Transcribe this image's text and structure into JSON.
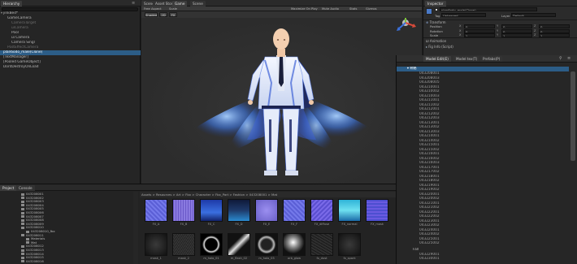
{
  "hierarchy": {
    "tab_label": "Hierarchy",
    "scene_name": "jinkBed*",
    "items": [
      {
        "text": "GameCamera",
        "indent": 1,
        "dim": false,
        "selected": false
      },
      {
        "text": "CameraTarget",
        "indent": 2,
        "dim": true,
        "selected": false
      },
      {
        "text": "uiCamera",
        "indent": 2,
        "dim": true,
        "selected": false
      },
      {
        "text": "Pool",
        "indent": 2,
        "dim": false,
        "selected": false
      },
      {
        "text": "ui Camera",
        "indent": 2,
        "dim": false,
        "selected": false
      },
      {
        "text": "Camera Singl",
        "indent": 2,
        "dim": false,
        "selected": false
      },
      {
        "text": "PostEffectCamera",
        "indent": 1,
        "dim": true,
        "selected": false
      },
      {
        "text": "plan6odo_male(Clone)",
        "indent": 0,
        "dim": false,
        "selected": true
      },
      {
        "text": "[TextManager]",
        "indent": 0,
        "dim": false,
        "selected": false
      },
      {
        "text": "[Pooled GameObject]",
        "indent": 0,
        "dim": false,
        "selected": false
      },
      {
        "text": "DontDestroyOnLoad",
        "indent": 0,
        "dim": false,
        "selected": false
      }
    ]
  },
  "scene": {
    "tabs": [
      "Scene",
      "Asset Store",
      "Game",
      "Scene"
    ],
    "toolbar": [
      "Free Aspect",
      "Scale",
      "Maximize On Play",
      "Mute Audio",
      "Stats",
      "Gizmos"
    ],
    "sub_toolbar": [
      "Shaded",
      "2D",
      "FX"
    ],
    "axes": {
      "y": "y",
      "x": "x",
      "z": "z"
    }
  },
  "inspector": {
    "tab_label": "Inspector",
    "object_name": "plan6odo_male(Clone)",
    "tag_label": "Tag",
    "tag_value": "Untagged",
    "layer_label": "Layer",
    "layer_value": "Default",
    "transform_label": "Transform",
    "position_label": "Position",
    "rotation_label": "Rotation",
    "scale_label": "Scale",
    "x": "X",
    "y": "Y",
    "z": "Z",
    "position_values": [
      "0",
      "0",
      "0"
    ],
    "rotation_values": [
      "0",
      "0",
      "0"
    ],
    "scale_values": [
      "1",
      "1",
      "1"
    ],
    "animation_label": "Animation",
    "script_label": "Fig Info (Script)"
  },
  "model_panel": {
    "tabs": [
      "Model Edit(E)",
      "Model tex(T)",
      "Prefabs(P)"
    ],
    "root_label": "骨骼",
    "entries": [
      "043208001",
      "043208003",
      "043208005",
      "043210001",
      "043210002",
      "043210003",
      "043211001",
      "043211002",
      "043212001",
      "043212002",
      "043212003",
      "043213001",
      "043213002",
      "043213003",
      "043214001",
      "043214002",
      "043215001",
      "043215002",
      "043216001",
      "043216002",
      "043216003",
      "043217001",
      "043217002",
      "043218001",
      "043218002",
      "043219001",
      "043219002",
      "043220001",
      "043220002",
      "043221001",
      "043221002",
      "043222001",
      "043222002",
      "043223001",
      "043223002",
      "043224001",
      "043224002",
      "043225001",
      "043225002"
    ],
    "footer_label": "Fall",
    "footer_entries": [
      "043229001",
      "043230001"
    ]
  },
  "project": {
    "tabs": [
      "Project",
      "Console"
    ],
    "breadcrumb": "Assets > Resources > Art > Fbx > Character > Fbx_Part > Fashion > 043208001 > Mat",
    "tree": [
      {
        "text": "043208001",
        "indent": 1
      },
      {
        "text": "043208002",
        "indent": 1
      },
      {
        "text": "043208003",
        "indent": 1
      },
      {
        "text": "043208004",
        "indent": 1
      },
      {
        "text": "043208005",
        "indent": 1
      },
      {
        "text": "043208006",
        "indent": 1
      },
      {
        "text": "043208007",
        "indent": 1
      },
      {
        "text": "043208008",
        "indent": 1
      },
      {
        "text": "043208009",
        "indent": 1
      },
      {
        "text": "043208010",
        "indent": 1
      },
      {
        "text": "043208010_fbx",
        "indent": 2
      },
      {
        "text": "043208011",
        "indent": 1
      },
      {
        "text": "Materials",
        "indent": 2
      },
      {
        "text": "Mat",
        "indent": 2
      },
      {
        "text": "043208012",
        "indent": 1
      },
      {
        "text": "043208013",
        "indent": 1
      },
      {
        "text": "043208014",
        "indent": 1
      },
      {
        "text": "043208015",
        "indent": 1
      },
      {
        "text": "043208016",
        "indent": 1
      }
    ],
    "assets_row1": [
      {
        "label": "FX_A",
        "kind": "purple"
      },
      {
        "label": "FX_B",
        "kind": "purple2"
      },
      {
        "label": "FX_C",
        "kind": "deepblue"
      },
      {
        "label": "FX_D",
        "kind": "navy"
      },
      {
        "label": "FX_E",
        "kind": "lavender"
      },
      {
        "label": "FX_F",
        "kind": "purple"
      },
      {
        "label": "FX_diffuse",
        "kind": "violet"
      },
      {
        "label": "FX_normal",
        "kind": "cyan"
      },
      {
        "label": "FX_mask",
        "kind": "bluepurple"
      }
    ],
    "assets_row2": [
      {
        "label": "mask_1",
        "kind": "dark"
      },
      {
        "label": "mask_2",
        "kind": "noise"
      },
      {
        "label": "m_halo_01",
        "kind": "ring"
      },
      {
        "label": "m_flash_02",
        "kind": "streak"
      },
      {
        "label": "m_halo_03",
        "kind": "ring2"
      },
      {
        "label": "orb_glow",
        "kind": "orb"
      },
      {
        "label": "fx_dust",
        "kind": "noise2"
      },
      {
        "label": "fx_spark",
        "kind": "dark"
      }
    ]
  },
  "colors": {
    "selection": "#2c5d87",
    "outfit_white": "#e8eef8",
    "outfit_blue": "#4a6fd8",
    "cape_glow": "#6aa6ff",
    "skin": "#f0c9a8"
  }
}
